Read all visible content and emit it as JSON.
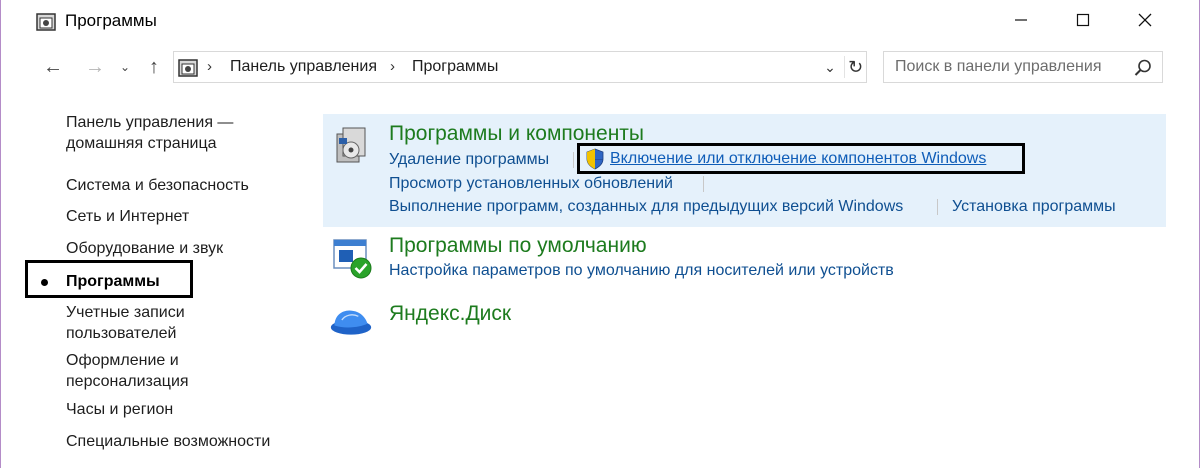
{
  "window": {
    "title": "Программы",
    "controls": {
      "minimize": "—",
      "maximize": "☐",
      "close": "✕"
    }
  },
  "nav": {
    "back": "←",
    "forward": "→",
    "recent": "⌄",
    "up": "↑",
    "separator": "›",
    "breadcrumbs": [
      "Панель управления",
      "Программы"
    ],
    "dropdown": "⌄",
    "refresh": "↻",
    "search_placeholder": "Поиск в панели управления"
  },
  "sidebar": {
    "home": [
      "Панель управления —",
      "домашняя страница"
    ],
    "items": [
      "Система и безопасность",
      "Сеть и Интернет",
      "Оборудование и звук",
      "Программы",
      [
        "Учетные записи",
        "пользователей"
      ],
      [
        "Оформление и",
        "персонализация"
      ],
      "Часы и регион",
      "Специальные возможности"
    ],
    "active_item": "Программы"
  },
  "categories": {
    "programs_features": {
      "title": "Программы и компоненты",
      "links": {
        "uninstall": "Удаление программы",
        "turn_features": "Включение или отключение компонентов Windows",
        "view_updates": "Просмотр установленных обновлений",
        "run_old": "Выполнение программ, созданных для предыдущих версий Windows",
        "how_install": "Установка программы"
      }
    },
    "default_programs": {
      "title": "Программы по умолчанию",
      "links": {
        "autoplay": "Настройка параметров по умолчанию для носителей или устройств"
      }
    },
    "yandex_disk": {
      "title": "Яндекс.Диск"
    }
  },
  "colors": {
    "category_title": "#1d7b1e",
    "link": "#0f4f91",
    "panel_highlight": "#e5f1fb",
    "window_border": "#b48cc8"
  }
}
